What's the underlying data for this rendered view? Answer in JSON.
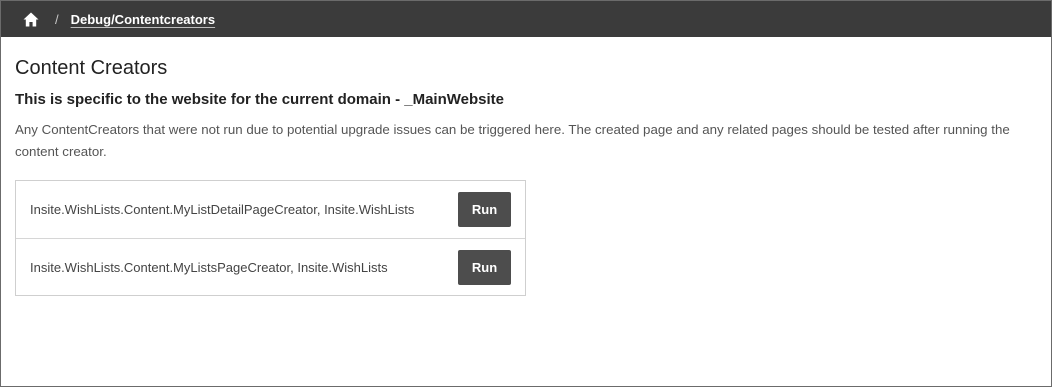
{
  "breadcrumb": {
    "home_icon": "home-icon",
    "separator": "/",
    "current": "Debug/Contentcreators"
  },
  "page": {
    "title": "Content Creators",
    "subtitle": "This is specific to the website for the current domain - _MainWebsite",
    "description": "Any ContentCreators that were not run due to potential upgrade issues can be triggered here. The created page and any related pages should be tested after running the content creator."
  },
  "creators": [
    {
      "name": "Insite.WishLists.Content.MyListDetailPageCreator, Insite.WishLists",
      "button_label": "Run"
    },
    {
      "name": "Insite.WishLists.Content.MyListsPageCreator, Insite.WishLists",
      "button_label": "Run"
    }
  ],
  "colors": {
    "topbar": "#3b3b3b",
    "button": "#4d4d4d",
    "border": "#cfcfcf"
  }
}
